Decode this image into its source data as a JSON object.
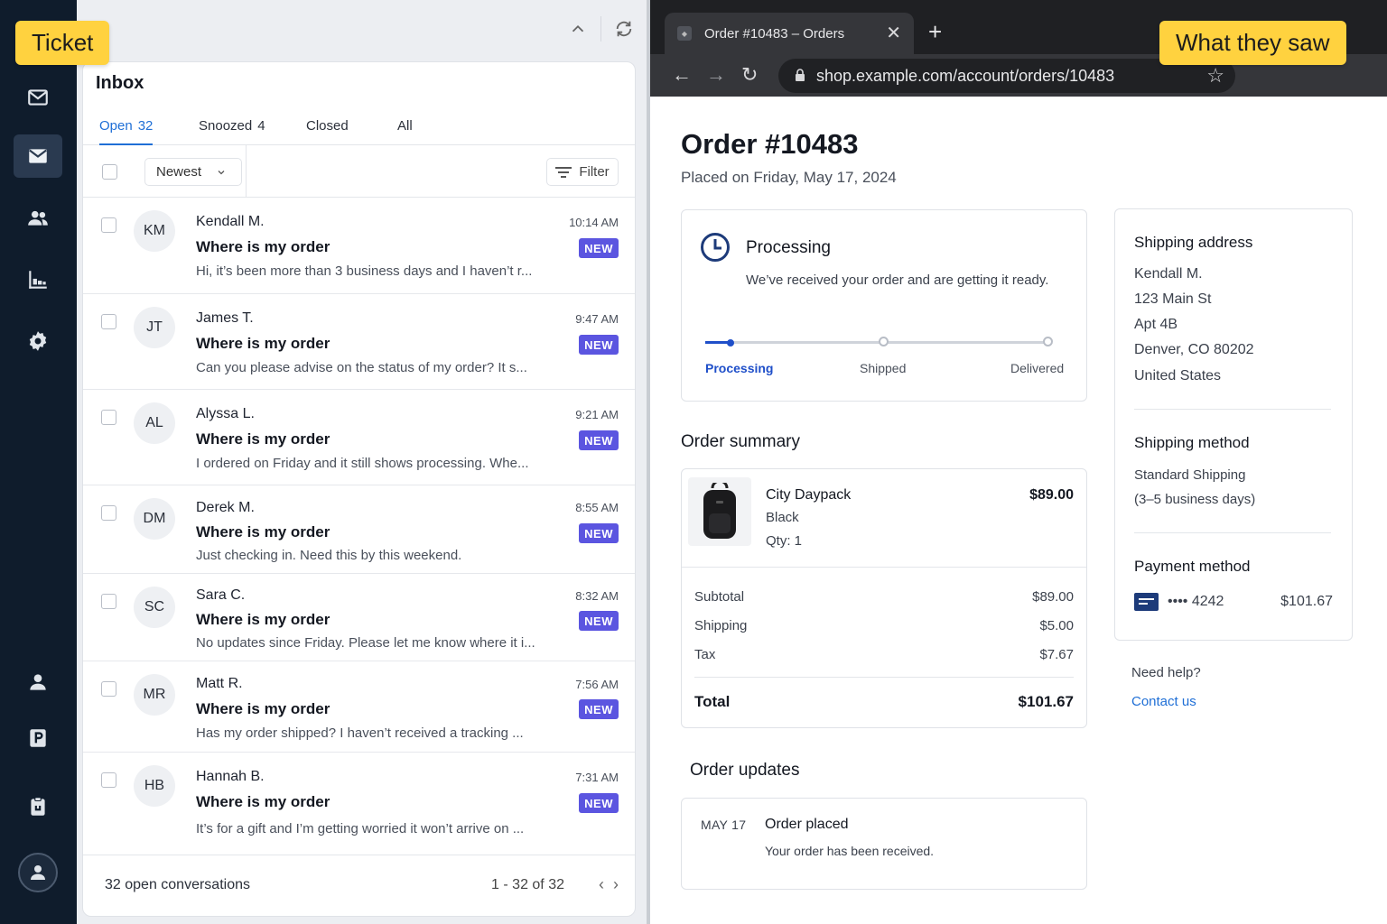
{
  "labels": {
    "left": "Ticket",
    "right": "What they saw"
  },
  "rail": {
    "icons": [
      "mail-icon",
      "inbox-icon",
      "users-icon",
      "reports-icon",
      "settings-icon",
      "agent-icon",
      "parking-icon",
      "clipboard-icon",
      "profile-icon"
    ]
  },
  "inbox": {
    "title": "Inbox",
    "tabs": [
      {
        "label": "Open",
        "count": "32"
      },
      {
        "label": "Snoozed",
        "count": "4"
      },
      {
        "label": "Closed",
        "count": ""
      },
      {
        "label": "All",
        "count": ""
      }
    ],
    "sort": "Newest",
    "filter": "Filter",
    "conversations": [
      {
        "initials": "KM",
        "name": "Kendall M.",
        "subject": "Where is my order",
        "preview": "Hi, it’s been more than 3 business days and I haven’t r...",
        "time": "10:14 AM",
        "badge": "NEW"
      },
      {
        "initials": "JT",
        "name": "James T.",
        "subject": "Where is my order",
        "preview": "Can you please advise on the status of my order? It s...",
        "time": "9:47 AM",
        "badge": "NEW"
      },
      {
        "initials": "AL",
        "name": "Alyssa L.",
        "subject": "Where is my order",
        "preview": "I ordered on Friday and it still shows processing. Whe...",
        "time": "9:21 AM",
        "badge": "NEW"
      },
      {
        "initials": "DM",
        "name": "Derek M.",
        "subject": "Where is my order",
        "preview": "Just checking in. Need this by this weekend.",
        "time": "8:55 AM",
        "badge": "NEW"
      },
      {
        "initials": "SC",
        "name": "Sara C.",
        "subject": "Where is my order",
        "preview": "No updates since Friday. Please let me know where it i...",
        "time": "8:32 AM",
        "badge": "NEW"
      },
      {
        "initials": "MR",
        "name": "Matt R.",
        "subject": "Where is my order",
        "preview": "Has my order shipped? I haven’t received a tracking ...",
        "time": "7:56 AM",
        "badge": "NEW"
      },
      {
        "initials": "HB",
        "name": "Hannah B.",
        "subject": "Where is my order",
        "preview": "It’s for a gift and I’m getting worried it won’t arrive on ...",
        "time": "7:31 AM",
        "badge": "NEW"
      }
    ],
    "footer": {
      "count": "32 open conversations",
      "range": "1 - 32 of 32"
    }
  },
  "browser": {
    "tab_title": "Order #10483 – Orders",
    "url": "shop.example.com/account/orders/10483"
  },
  "order": {
    "title": "Order #10483",
    "placed": "Placed on Friday, May 17, 2024",
    "status": {
      "title": "Processing",
      "text": "We’ve received your order and are getting it ready.",
      "steps": [
        "Processing",
        "Shipped",
        "Delivered"
      ],
      "progress": 0.07
    },
    "summary": {
      "heading": "Order summary",
      "item": {
        "name": "City Daypack",
        "color": "Black",
        "qty": "Qty: 1",
        "price": "$89.00"
      },
      "rows": [
        {
          "label": "Subtotal",
          "value": "$89.00"
        },
        {
          "label": "Shipping",
          "value": "$5.00"
        },
        {
          "label": "Tax",
          "value": "$7.67"
        }
      ],
      "total_label": "Total",
      "total_value": "$101.67"
    },
    "updates": {
      "heading": "Order updates",
      "date": "MAY 17",
      "title": "Order placed",
      "text": "Your order has been received."
    },
    "shipping_address": {
      "heading": "Shipping address",
      "lines": [
        "Kendall M.",
        "123 Main St",
        "Apt 4B",
        "Denver, CO 80202",
        "United States"
      ]
    },
    "shipping_method": {
      "heading": "Shipping method",
      "lines": [
        "Standard Shipping",
        "(3–5 business days)"
      ]
    },
    "payment": {
      "heading": "Payment method",
      "card": "•••• 4242",
      "amount": "$101.67"
    },
    "help": {
      "question": "Need help?",
      "link": "Contact us"
    }
  }
}
